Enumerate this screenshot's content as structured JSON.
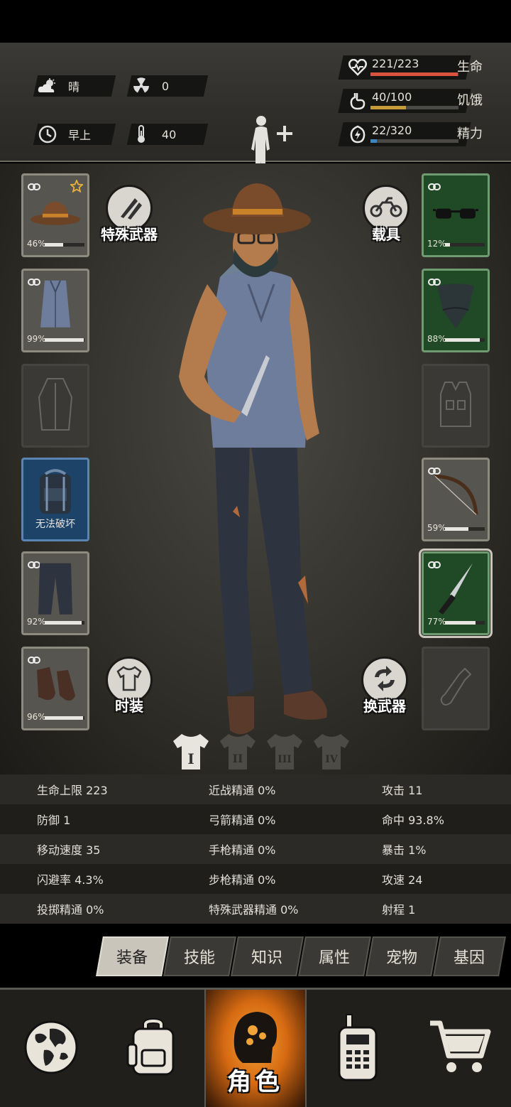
{
  "header": {
    "weather": {
      "icon": "cloud-sun-icon",
      "text": "晴"
    },
    "radiation": {
      "icon": "radiation-icon",
      "value": "0"
    },
    "time": {
      "icon": "clock-icon",
      "text": "早上"
    },
    "temperature": {
      "icon": "thermometer-icon",
      "value": "40"
    },
    "stats": [
      {
        "icon": "heart-icon",
        "value": "221/223",
        "label": "生命",
        "fill": 0.991,
        "color": "#d9533f"
      },
      {
        "icon": "stomach-icon",
        "value": "40/100",
        "label": "饥饿",
        "fill": 0.4,
        "color": "#c79a3a"
      },
      {
        "icon": "energy-icon",
        "value": "22/320",
        "label": "精力",
        "fill": 0.069,
        "color": "#3d86c6"
      }
    ]
  },
  "equipment": {
    "left": [
      {
        "name": "hat",
        "pct": "46%",
        "durability": 0.46,
        "star": true
      },
      {
        "name": "shirt",
        "pct": "99%",
        "durability": 0.99
      },
      {
        "name": "coat-empty"
      },
      {
        "name": "backpack",
        "caption": "无法破坏"
      },
      {
        "name": "pants",
        "pct": "92%",
        "durability": 0.92
      },
      {
        "name": "shoes",
        "pct": "96%",
        "durability": 0.96
      }
    ],
    "right": [
      {
        "name": "glasses",
        "pct": "12%",
        "durability": 0.12
      },
      {
        "name": "bandana",
        "pct": "88%",
        "durability": 0.88
      },
      {
        "name": "vest-empty"
      },
      {
        "name": "bow",
        "pct": "59%",
        "durability": 0.59
      },
      {
        "name": "knife",
        "pct": "77%",
        "durability": 0.77
      },
      {
        "name": "throwable-empty"
      }
    ],
    "buttons": {
      "special_weapon": "特殊武器",
      "vehicle": "载具",
      "fashion": "时装",
      "switch_weapon": "换武器"
    },
    "set_tabs": [
      "I",
      "II",
      "III",
      "IV"
    ]
  },
  "stats": [
    [
      "生命上限 223",
      "近战精通 0%",
      "攻击 11"
    ],
    [
      "防御 1",
      "弓箭精通 0%",
      "命中 93.8%"
    ],
    [
      "移动速度 35",
      "手枪精通 0%",
      "暴击 1%"
    ],
    [
      "闪避率 4.3%",
      "步枪精通 0%",
      "攻速 24"
    ],
    [
      "投掷精通 0%",
      "特殊武器精通 0%",
      "射程 1"
    ]
  ],
  "section_tabs": [
    "装备",
    "技能",
    "知识",
    "属性",
    "宠物",
    "基因"
  ],
  "nav": [
    {
      "icon": "globe-icon"
    },
    {
      "icon": "backpack-icon"
    },
    {
      "icon": "character-head-icon",
      "label": "角色"
    },
    {
      "icon": "walkie-talkie-icon"
    },
    {
      "icon": "cart-icon"
    }
  ]
}
